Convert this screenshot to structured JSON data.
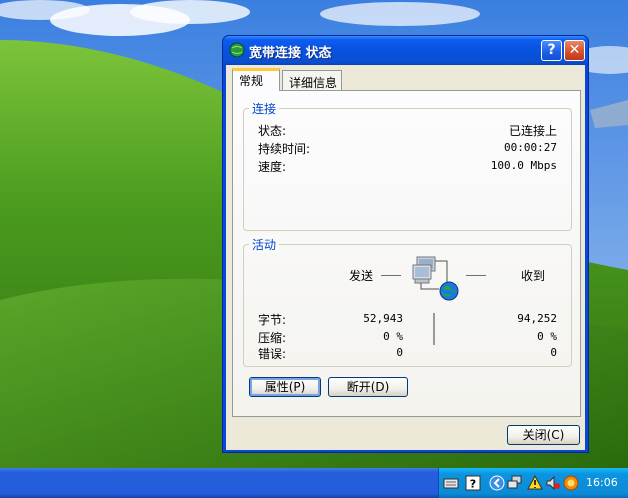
{
  "window": {
    "title": "宽带连接 状态",
    "help_label": "?",
    "close_label": "✕"
  },
  "tabs": [
    {
      "label": "常规",
      "active": true
    },
    {
      "label": "详细信息",
      "active": false
    }
  ],
  "connection": {
    "legend": "连接",
    "status_label": "状态:",
    "status_value": "已连接上",
    "duration_label": "持续时间:",
    "duration_value": "00:00:27",
    "speed_label": "速度:",
    "speed_value": "100.0 Mbps"
  },
  "activity": {
    "legend": "活动",
    "sent_label": "发送",
    "received_label": "收到",
    "bytes_label": "字节:",
    "bytes_sent": "52,943",
    "bytes_received": "94,252",
    "compression_label": "压缩:",
    "compression_sent": "0 %",
    "compression_received": "0 %",
    "errors_label": "错误:",
    "errors_sent": "0",
    "errors_received": "0"
  },
  "buttons": {
    "properties_label": "属性",
    "properties_key": "(P)",
    "disconnect_label": "断开",
    "disconnect_key": "(D)",
    "close_label": "关闭",
    "close_key": "(C)"
  },
  "taskbar": {
    "clock": "16:06",
    "tray_icons": [
      "keyboard-icon",
      "help-icon",
      "show-hidden-icon",
      "network-icon",
      "warning-icon",
      "volume-icon",
      "antivirus-icon"
    ]
  },
  "colors": {
    "title_bar": "#0a54e4",
    "legend_text": "#0046d5",
    "taskbar": "#245edb",
    "tray": "#0d8ad6"
  }
}
